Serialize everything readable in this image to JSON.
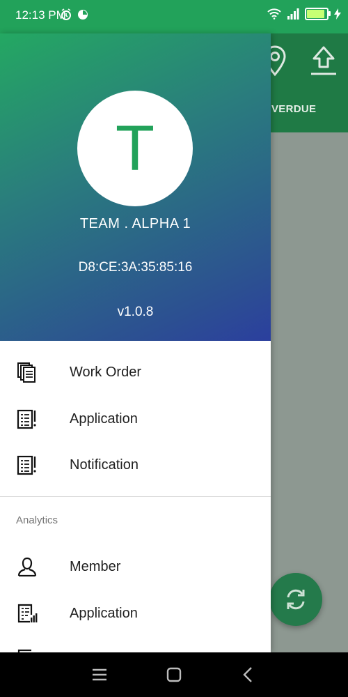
{
  "status_bar": {
    "time": "12:13 PM",
    "battery_level": 0.9,
    "accent_color": "#22a25a"
  },
  "background_app": {
    "tab_label": "OVERDUE",
    "toolbar_color": "#1f7a45",
    "icons": [
      "location-pin-icon",
      "upload-icon",
      "refresh-icon"
    ]
  },
  "drawer": {
    "header": {
      "avatar_letter": "T",
      "team_name": "TEAM . ALPHA 1",
      "mac_address": "D8:CE:3A:35:85:16",
      "version": "v1.0.8"
    },
    "menu_items": [
      {
        "label": "Work Order",
        "icon": "work-order-icon"
      },
      {
        "label": "Application",
        "icon": "application-icon"
      },
      {
        "label": "Notification",
        "icon": "notification-icon"
      }
    ],
    "analytics": {
      "section_title": "Analytics",
      "items": [
        {
          "label": "Member",
          "icon": "member-icon"
        },
        {
          "label": "Application",
          "icon": "application-analytics-icon"
        }
      ]
    }
  },
  "navigation_bar": {
    "buttons": [
      "menu-icon",
      "home-icon",
      "back-icon"
    ]
  }
}
